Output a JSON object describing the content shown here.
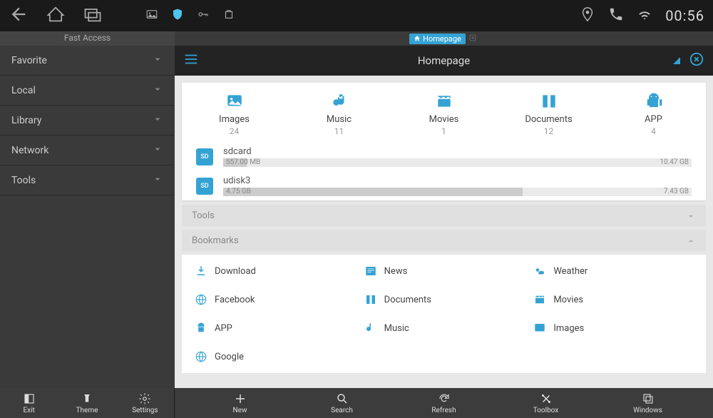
{
  "status_bar": {
    "time": "00:56"
  },
  "sidebar": {
    "header": "Fast Access",
    "items": [
      {
        "label": "Favorite"
      },
      {
        "label": "Local"
      },
      {
        "label": "Library"
      },
      {
        "label": "Network"
      },
      {
        "label": "Tools"
      }
    ]
  },
  "content": {
    "tab_label": "Homepage",
    "title": "Homepage",
    "categories": [
      {
        "label": "Images",
        "count": "24"
      },
      {
        "label": "Music",
        "count": "11"
      },
      {
        "label": "Movies",
        "count": "1"
      },
      {
        "label": "Documents",
        "count": "12"
      },
      {
        "label": "APP",
        "count": "4"
      }
    ],
    "storage": [
      {
        "name": "sdcard",
        "used": "557.00 MB",
        "total": "10.47 GB",
        "pct": 5
      },
      {
        "name": "udisk3",
        "used": "4.75 GB",
        "total": "7.43 GB",
        "pct": 64
      }
    ],
    "sections": {
      "tools": "Tools",
      "bookmarks": "Bookmarks"
    },
    "bookmarks": [
      {
        "label": "Download"
      },
      {
        "label": "News"
      },
      {
        "label": "Weather"
      },
      {
        "label": "Facebook"
      },
      {
        "label": "Documents"
      },
      {
        "label": "Movies"
      },
      {
        "label": "APP"
      },
      {
        "label": "Music"
      },
      {
        "label": "Images"
      },
      {
        "label": "Google"
      }
    ]
  },
  "bottom_bar": {
    "left": [
      {
        "label": "Exit"
      },
      {
        "label": "Theme"
      },
      {
        "label": "Settings"
      }
    ],
    "right": [
      {
        "label": "New"
      },
      {
        "label": "Search"
      },
      {
        "label": "Refresh"
      },
      {
        "label": "Toolbox"
      },
      {
        "label": "Windows"
      }
    ]
  }
}
